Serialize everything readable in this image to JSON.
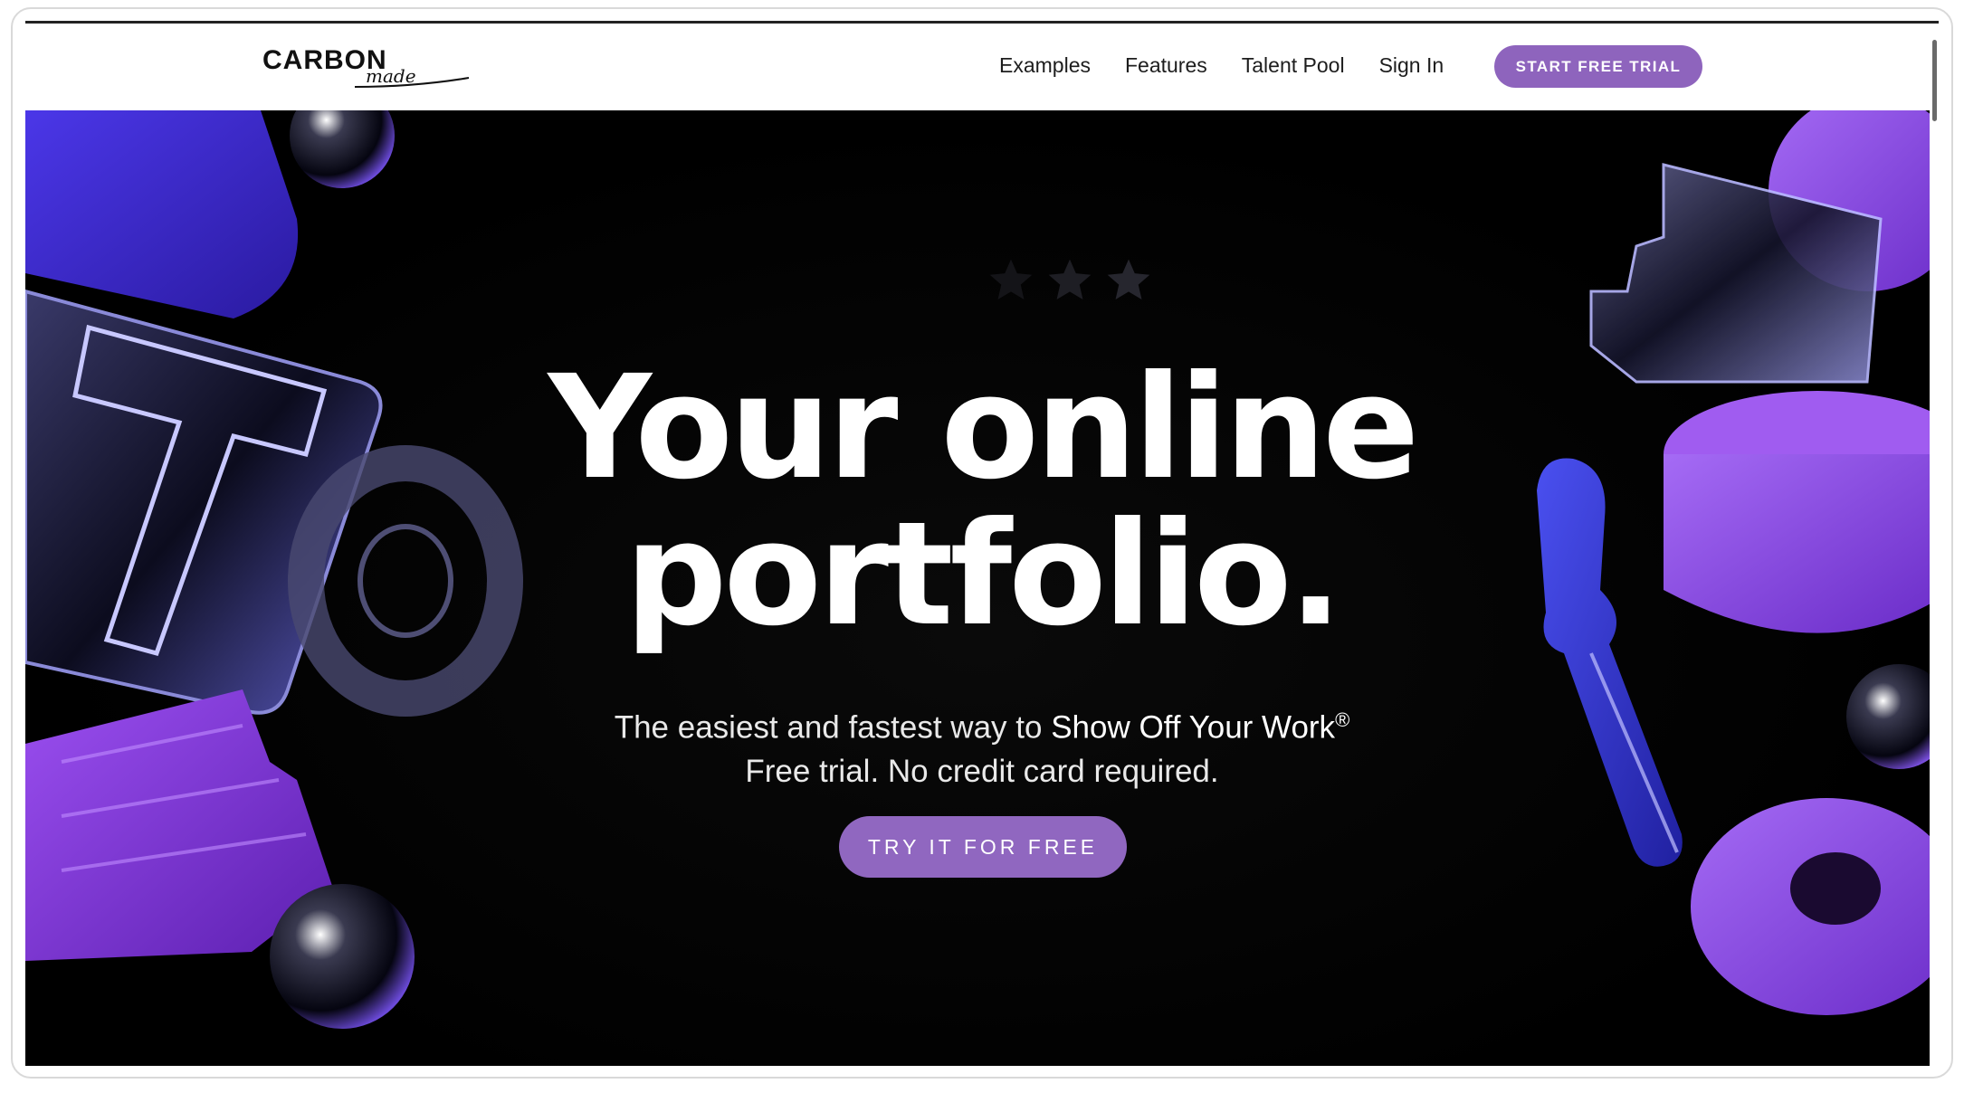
{
  "brand": {
    "logo_word": "CARBON",
    "logo_script": "made"
  },
  "nav": {
    "links": [
      "Examples",
      "Features",
      "Talent Pool",
      "Sign In"
    ],
    "cta": "START FREE TRIAL"
  },
  "hero": {
    "headline_line1": "Your online",
    "headline_line2": "portfolio.",
    "sub_prefix": "The easiest and fastest way to ",
    "sub_emphasis": "Show Off Your Work",
    "sub_mark": "®",
    "sub_line2": "Free trial. No credit card required.",
    "cta": "TRY IT FOR FREE",
    "rating_icons": [
      "star-icon",
      "star-icon",
      "star-icon"
    ]
  },
  "colors": {
    "accent": "#8e64bd",
    "purple_shape": "#7d3ee0",
    "blue_shape": "#3d2fd6",
    "hero_bg": "#000000"
  }
}
